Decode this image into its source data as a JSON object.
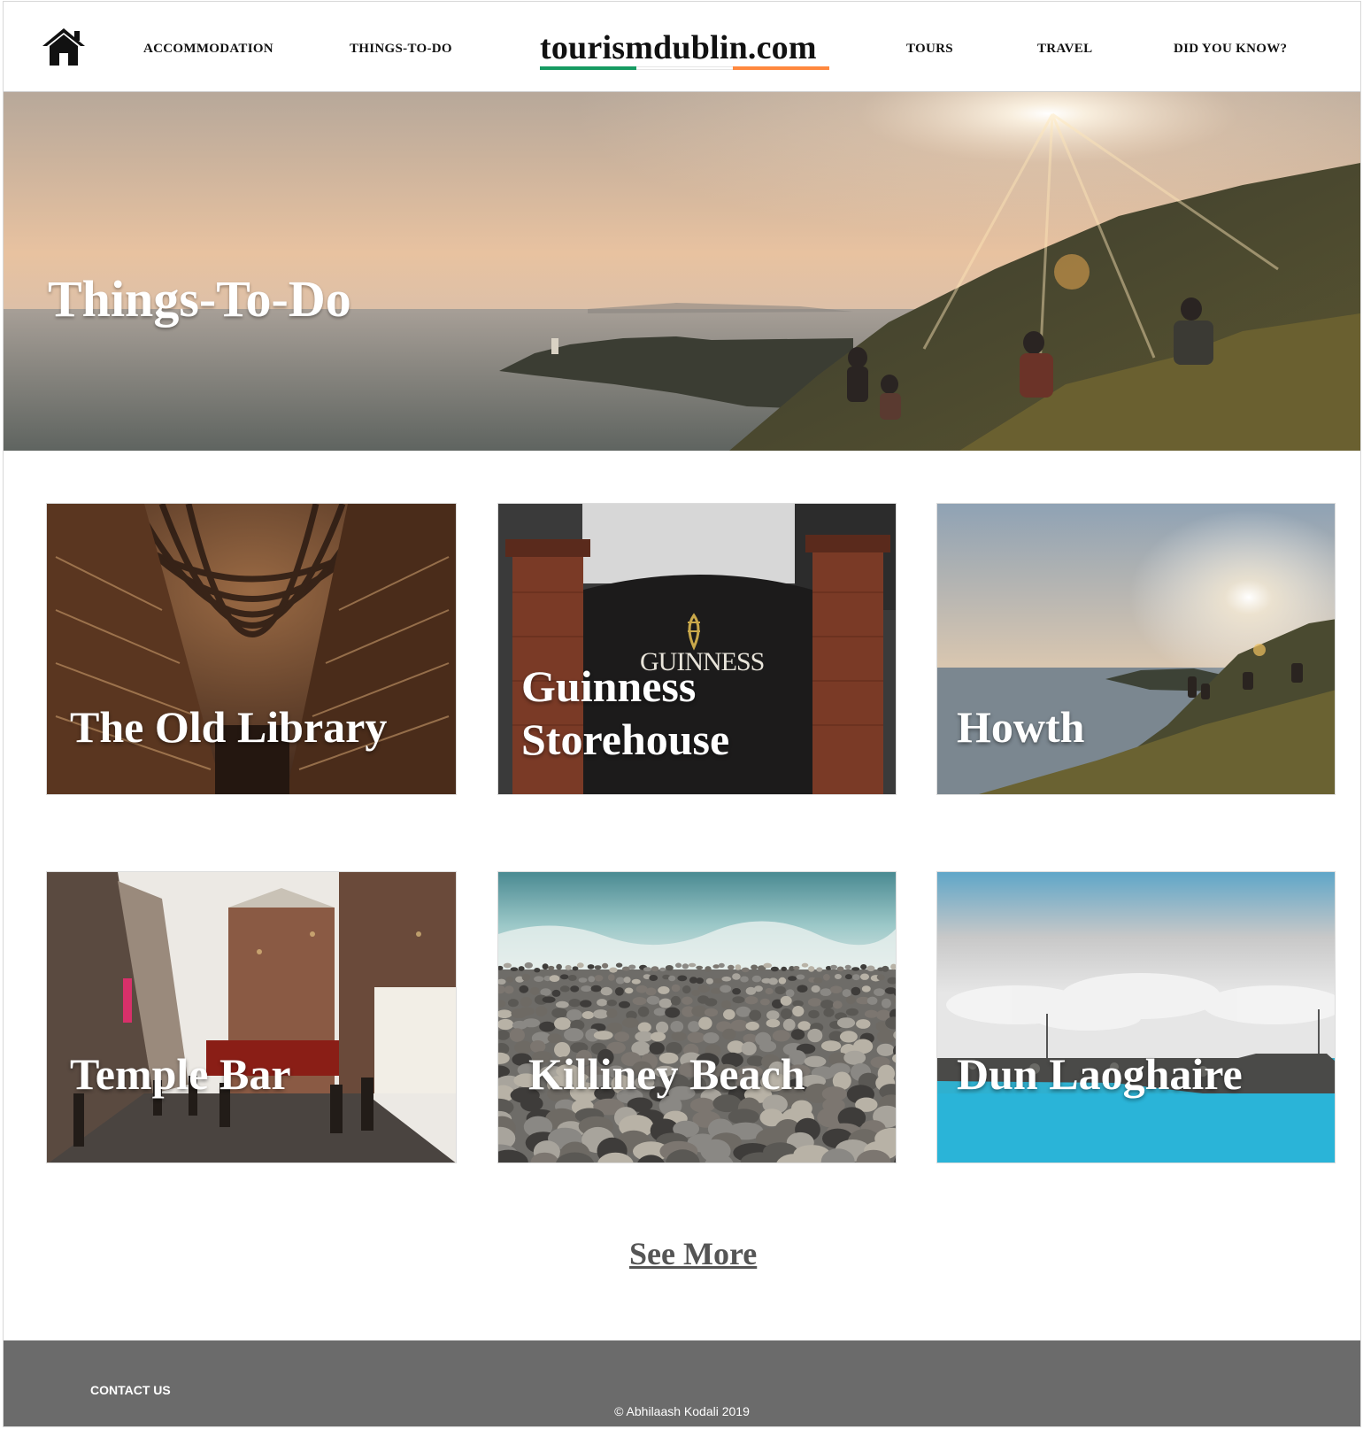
{
  "header": {
    "logo_text": "tourismdublin.com",
    "nav": {
      "accommodation": "ACCOMMODATION",
      "things_to_do": "THINGS-TO-DO",
      "tours": "TOURS",
      "travel": "TRAVEL",
      "did_you_know": "DID YOU KNOW?"
    },
    "home_icon": "home-icon",
    "flag_colors": [
      "#169b62",
      "#ffffff",
      "#ff883e"
    ]
  },
  "hero": {
    "title": "Things-To-Do"
  },
  "cards": [
    {
      "title": "The Old Library"
    },
    {
      "title": "Guinness Storehouse"
    },
    {
      "title": "Howth"
    },
    {
      "title": "Temple Bar"
    },
    {
      "title": "Killiney Beach"
    },
    {
      "title": "Dun Laoghaire"
    }
  ],
  "guinness_sign": "GUINNESS",
  "see_more": "See More",
  "footer": {
    "contact": "CONTACT US",
    "copyright": "© Abhilaash Kodali 2019"
  }
}
